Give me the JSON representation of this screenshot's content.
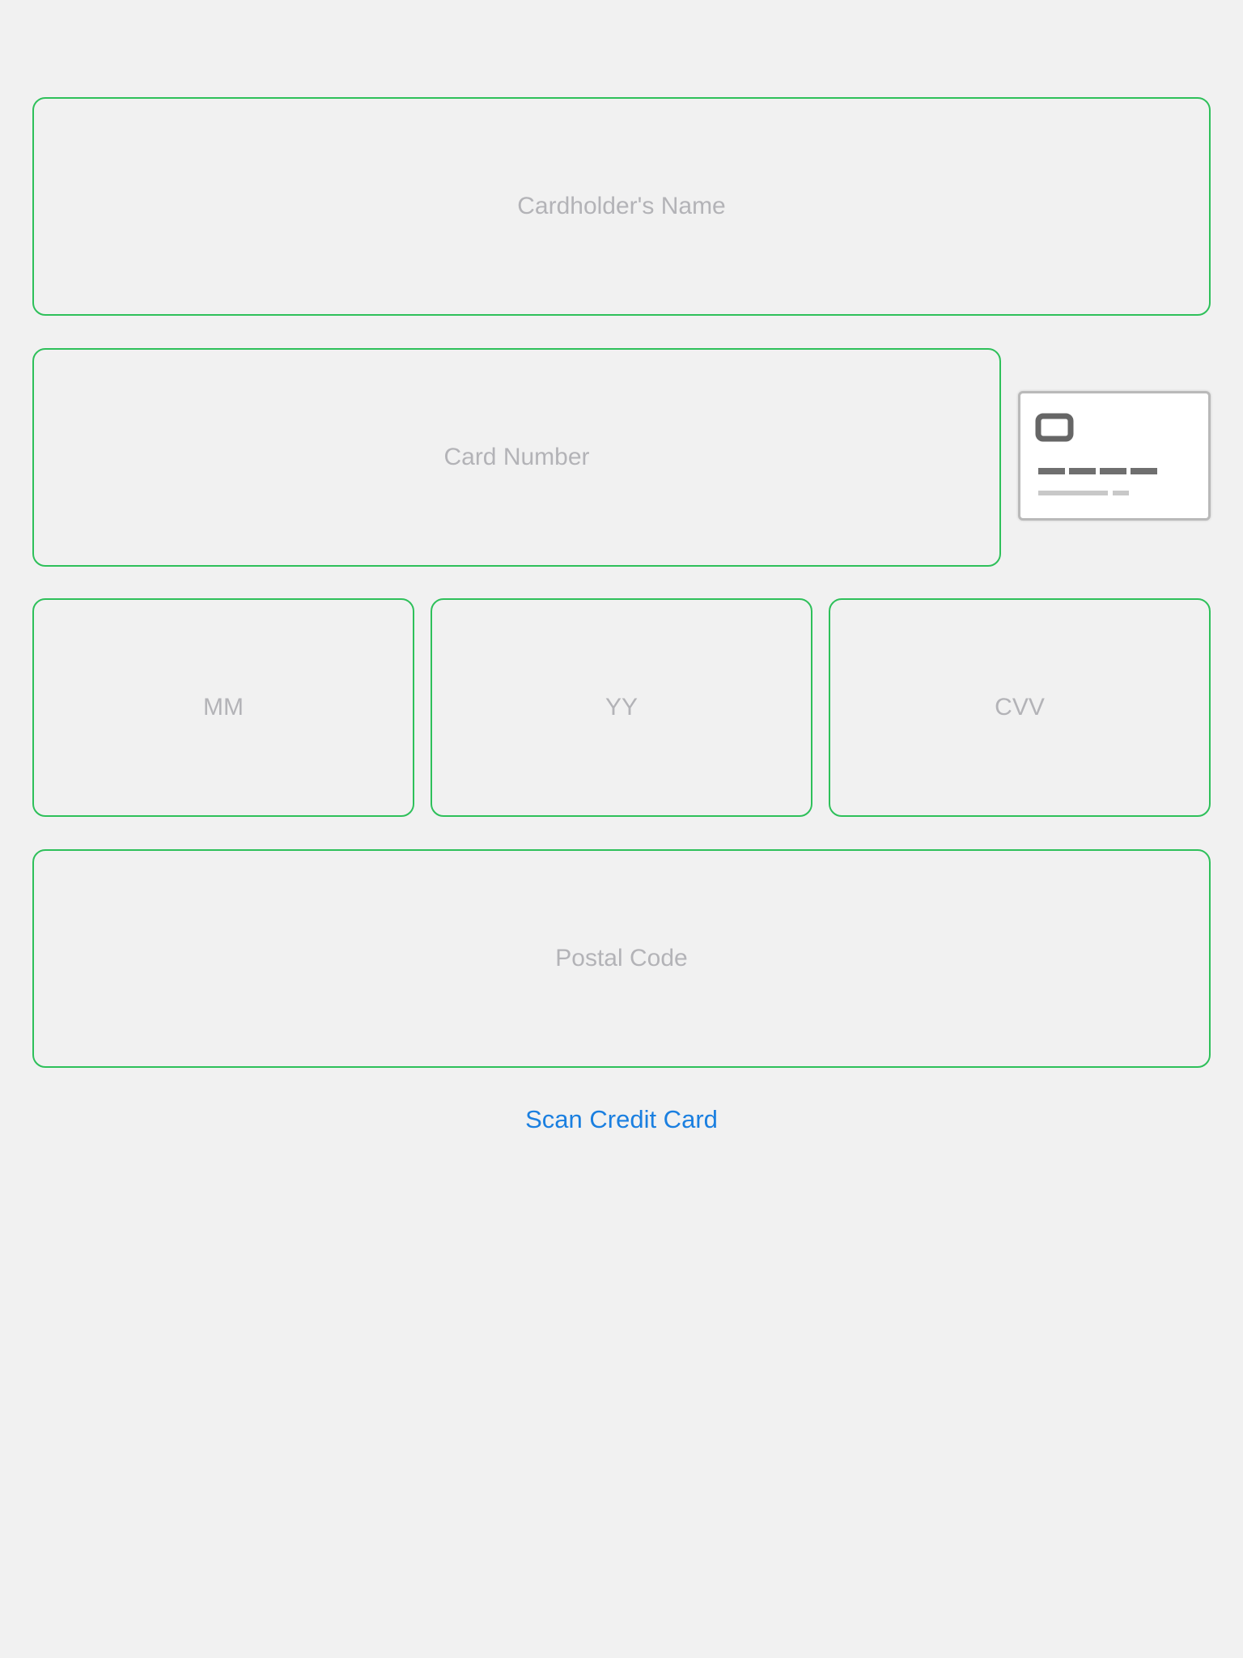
{
  "form": {
    "cardholder_name": {
      "placeholder": "Cardholder's Name",
      "value": ""
    },
    "card_number": {
      "placeholder": "Card Number",
      "value": ""
    },
    "expiry_month": {
      "placeholder": "MM",
      "value": ""
    },
    "expiry_year": {
      "placeholder": "YY",
      "value": ""
    },
    "cvv": {
      "placeholder": "CVV",
      "value": ""
    },
    "postal_code": {
      "placeholder": "Postal Code",
      "value": ""
    }
  },
  "card_brand_icon": "generic-credit-card-icon",
  "scan_link_label": "Scan Credit Card",
  "colors": {
    "background": "#f1f1f1",
    "field_border": "#2ec05a",
    "placeholder": "#b3b3b7",
    "link": "#1a7fe0"
  }
}
